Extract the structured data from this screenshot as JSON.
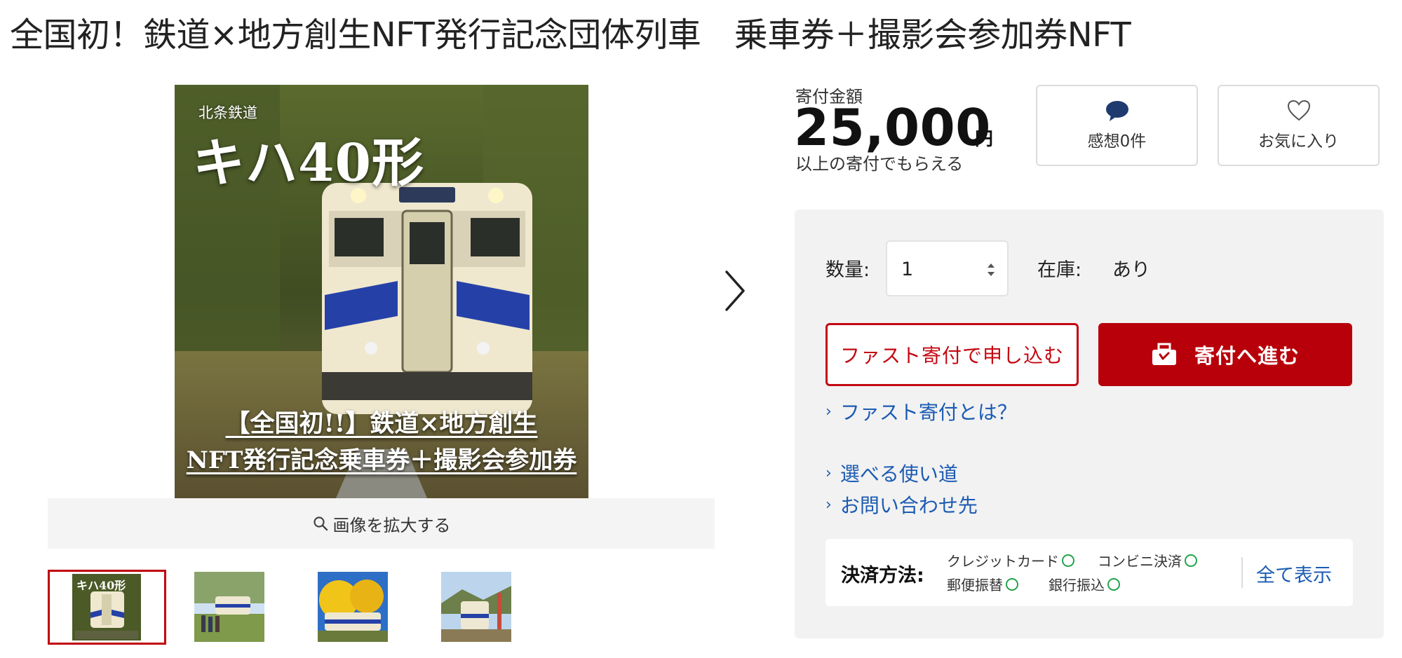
{
  "page": {
    "title": "全国初！鉄道×地方創生NFT発行記念団体列車　乗車券＋撮影会参加券NFT"
  },
  "gallery": {
    "main_image": {
      "caption_top": "北条鉄道",
      "title": "キハ40形",
      "subtitle_line1": "【全国初!!】鉄道×地方創生",
      "subtitle_line2": "NFT発行記念乗車券＋撮影会参加券"
    },
    "thumb_caption": "キハ40形",
    "zoom_label": "画像を拡大する",
    "thumbnail_count": 4,
    "selected_thumbnail": 1
  },
  "donation": {
    "amount_label": "寄付金額",
    "amount": "25,000",
    "unit": "円",
    "note": "以上の寄付でもらえる"
  },
  "actions": {
    "comments_label": "感想0件",
    "favorite_label": "お気に入り"
  },
  "order": {
    "quantity_label": "数量:",
    "quantity_value": "1",
    "stock_label": "在庫:",
    "stock_value": "あり",
    "fast_button": "ファスト寄付で申し込む",
    "donate_button": "寄付へ進む"
  },
  "links": {
    "fast_info": "ファスト寄付とは？",
    "usage": "選べる使い道",
    "contact": "お問い合わせ先"
  },
  "payment": {
    "title": "決済方法:",
    "methods": [
      "クレジットカード",
      "コンビニ決済",
      "郵便振替",
      "銀行振込"
    ],
    "show_all": "全て表示"
  },
  "colors": {
    "accent_red": "#b8000a",
    "link_blue": "#1b5bb3",
    "ok_green": "#22a44a",
    "comment_icon": "#1f3a6e"
  },
  "icons": {
    "zoom": "magnifier-icon",
    "next": "chevron-right-icon",
    "comments": "speech-bubble-icon",
    "favorite": "heart-outline-icon",
    "donate": "gift-box-icon",
    "link_chevron": "chevron-right-icon",
    "payment_ok": "circle-ok-icon"
  }
}
